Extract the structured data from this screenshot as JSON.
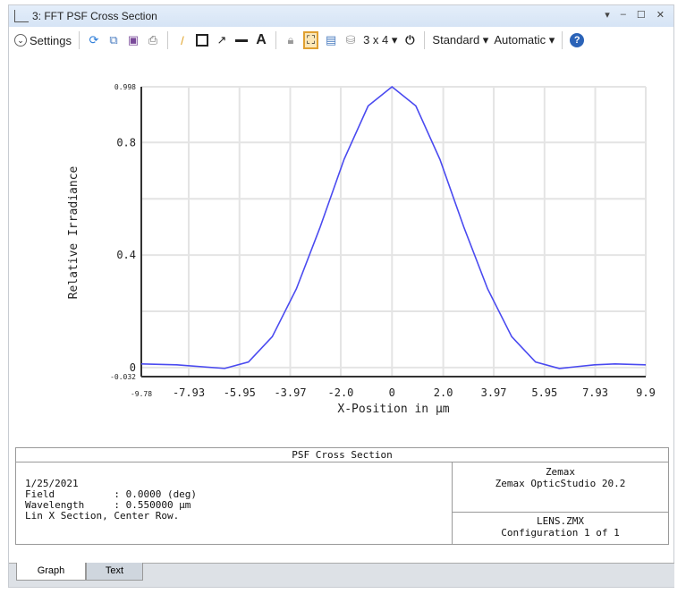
{
  "window": {
    "title": "3: FFT PSF Cross Section",
    "controls": [
      "▾",
      "–",
      "☐",
      "✕"
    ]
  },
  "toolbar": {
    "settings": "Settings",
    "layout": "3 x 4 ▾",
    "standard": "Standard ▾",
    "automatic": "Automatic ▾"
  },
  "chart_data": {
    "type": "line",
    "title": "PSF Cross Section",
    "xlabel": "X-Position in µm",
    "ylabel": "Relative Irradiance",
    "xlim": [
      -9.78,
      9.9
    ],
    "ylim": [
      -0.032,
      0.998
    ],
    "xticks": [
      "-9.78",
      "-7.93",
      "-5.95",
      "-3.97",
      "-2.0",
      "0",
      "2.0",
      "3.97",
      "5.95",
      "7.93",
      "9.9"
    ],
    "xtick_values": [
      -9.78,
      -7.93,
      -5.95,
      -3.97,
      -2.0,
      0,
      2.0,
      3.97,
      5.95,
      7.93,
      9.9
    ],
    "yticks": [
      "0.998",
      "0.8",
      "0.4",
      "0",
      "-0.032"
    ],
    "ytick_values": [
      0.998,
      0.8,
      0.4,
      0,
      -0.032
    ],
    "ygrid": [
      0,
      0.2,
      0.4,
      0.6,
      0.8,
      0.998
    ],
    "grid": true,
    "color": "#4a4af0",
    "x": [
      -9.78,
      -8.4,
      -6.53,
      -5.6,
      -4.67,
      -3.73,
      -2.8,
      -1.87,
      -0.93,
      0,
      0.93,
      1.87,
      2.8,
      3.73,
      4.67,
      5.6,
      6.53,
      7.9,
      8.7,
      9.9
    ],
    "y": [
      0.013,
      0.01,
      -0.003,
      0.02,
      0.11,
      0.28,
      0.5,
      0.74,
      0.93,
      0.998,
      0.93,
      0.74,
      0.5,
      0.28,
      0.11,
      0.02,
      -0.003,
      0.01,
      0.013,
      0.01
    ]
  },
  "panel": {
    "title": "PSF Cross Section",
    "left": "1/25/2021\nField          : 0.0000 (deg)\nWavelength     : 0.550000 µm\nLin X Section, Center Row.",
    "right_top_1": "Zemax",
    "right_top_2": "Zemax OpticStudio 20.2",
    "right_bottom_1": "LENS.ZMX",
    "right_bottom_2": "Configuration 1 of 1"
  },
  "tabs": [
    "Graph",
    "Text"
  ]
}
